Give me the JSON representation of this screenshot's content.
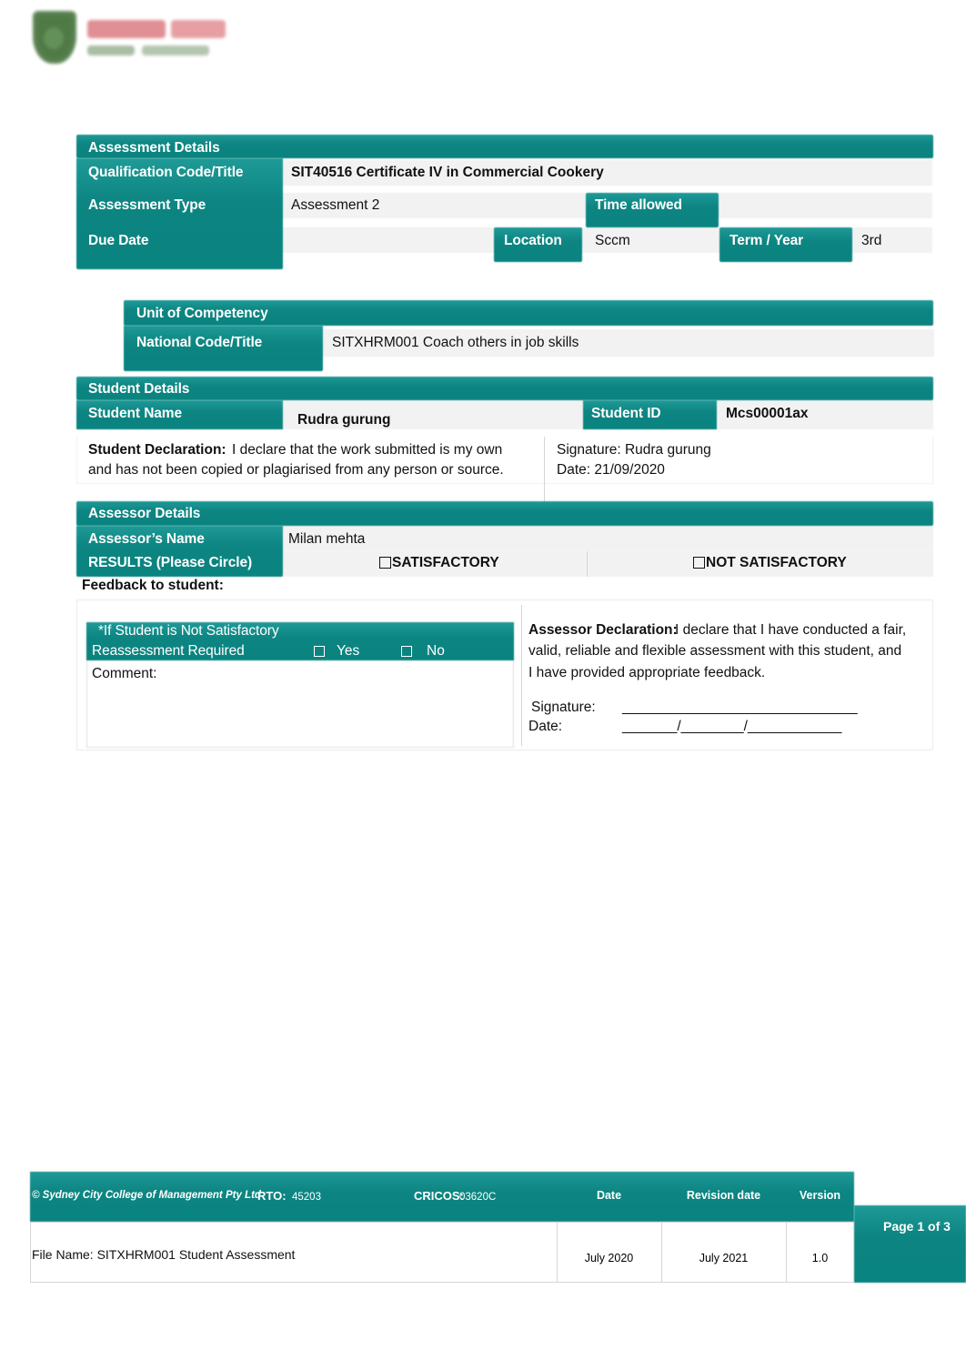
{
  "logo": {
    "alt": "Sydney City College of Management logo"
  },
  "assessment_details": {
    "section_title": "Assessment Details",
    "qualification_label": "Qualification Code/Title",
    "qualification_value": "SIT40516 Certificate IV in Commercial Cookery",
    "type_label": "Assessment Type",
    "type_value": "Assessment 2",
    "time_allowed_label": "Time allowed",
    "time_allowed_value": "",
    "due_date_label": "Due Date",
    "due_date_value": "",
    "location_label": "Location",
    "location_value": "Sccm",
    "term_year_label": "Term / Year",
    "term_year_value": "3rd"
  },
  "unit_of_competency": {
    "section_title": "Unit of Competency",
    "national_code_label": "National Code/Title",
    "national_code_value": "SITXHRM001 Coach others in job skills"
  },
  "student_details": {
    "section_title": "Student Details",
    "name_label": "Student Name",
    "name_value": "Rudra gurung",
    "id_label": "Student ID",
    "id_value": "Mcs00001ax",
    "declaration_label": "Student Declaration:",
    "declaration_text_line1": "I declare that the work submitted is my own",
    "declaration_text_line2": "and has not been copied or plagiarised from any person or source.",
    "signature_line": "Signature: Rudra gurung",
    "date_line": "Date:   21/09/2020"
  },
  "assessor_details": {
    "section_title": "Assessor Details",
    "name_label": "Assessor’s Name",
    "name_value": "Milan mehta",
    "results_label": "RESULTS (Please Circle)",
    "result_satisfactory": "SATISFACTORY",
    "result_not_satisfactory": "NOT SATISFACTORY",
    "feedback_label": "Feedback to student:"
  },
  "reassessment": {
    "note": "*If Student is Not Satisfactory",
    "required_label": "Reassessment Required",
    "yes_label": "Yes",
    "no_label": "No",
    "comment_label": "Comment:"
  },
  "assessor_declaration": {
    "label": "Assessor Declaration:",
    "line1": "I declare that I have conducted a fair,",
    "line2": "valid, reliable and flexible assessment with this student, and",
    "line3": "I have provided appropriate feedback.",
    "signature_label": "Signature:",
    "signature_rule": "______________________________",
    "date_label": "Date:",
    "date_rule": "_______/________/____________"
  },
  "footer": {
    "copyright": "© Sydney City College of Management Pty Ltd",
    "rto_label": "RTO:",
    "rto_value": "45203",
    "cricos_label": "CRICOS:",
    "cricos_value": "03620C",
    "col_date": "Date",
    "col_revision": "Revision date",
    "col_version": "Version",
    "file_name": "File Name: SITXHRM001 Student Assessment",
    "date_value": "July 2020",
    "revision_value": "July 2021",
    "version_value": "1.0",
    "page_label": "Page 1 of 3"
  },
  "colors": {
    "teal": "#0d8582",
    "teal_light": "#1f9a97",
    "band_grey": "#f2f2f2"
  }
}
